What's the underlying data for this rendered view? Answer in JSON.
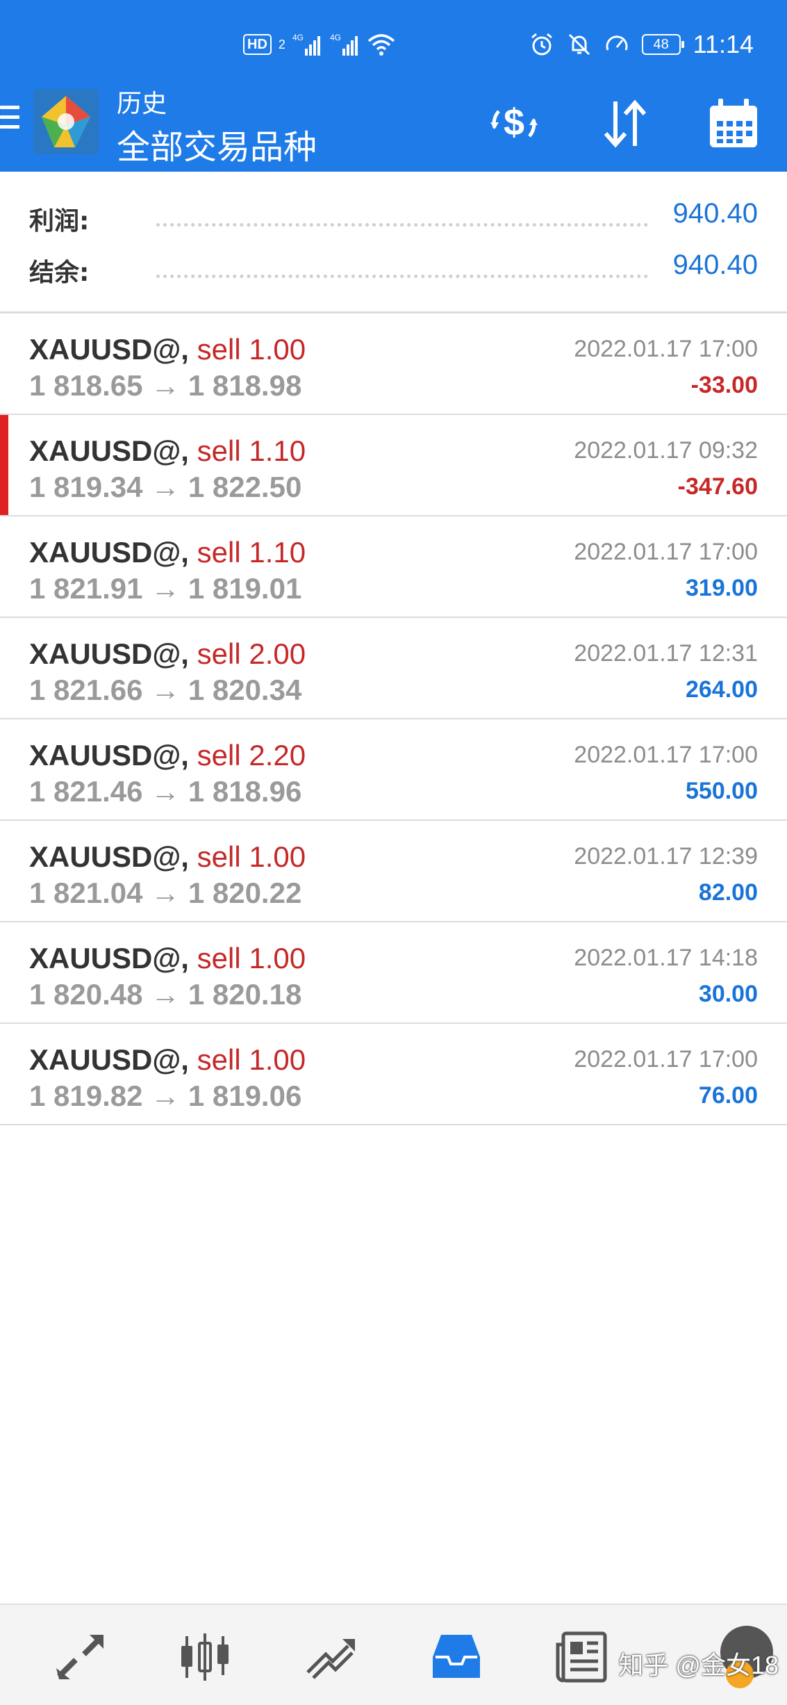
{
  "status_bar": {
    "hd_label": "HD",
    "hd_sub": "2",
    "battery": "48",
    "time": "11:14"
  },
  "header": {
    "subtitle": "历史",
    "title": "全部交易品种"
  },
  "summary": {
    "profit_label": "利润:",
    "profit_value": "940.40",
    "balance_label": "结余:",
    "balance_value": "940.40"
  },
  "trades": [
    {
      "symbol": "XAUUSD@,",
      "side": "sell 1.00",
      "prices": "1 818.65 → 1 818.98",
      "time": "2022.01.17 17:00",
      "profit": "-33.00"
    },
    {
      "symbol": "XAUUSD@,",
      "side": "sell 1.10",
      "prices": "1 819.34 → 1 822.50",
      "time": "2022.01.17 09:32",
      "profit": "-347.60"
    },
    {
      "symbol": "XAUUSD@,",
      "side": "sell 1.10",
      "prices": "1 821.91 → 1 819.01",
      "time": "2022.01.17 17:00",
      "profit": "319.00"
    },
    {
      "symbol": "XAUUSD@,",
      "side": "sell 2.00",
      "prices": "1 821.66 → 1 820.34",
      "time": "2022.01.17 12:31",
      "profit": "264.00"
    },
    {
      "symbol": "XAUUSD@,",
      "side": "sell 2.20",
      "prices": "1 821.46 → 1 818.96",
      "time": "2022.01.17 17:00",
      "profit": "550.00"
    },
    {
      "symbol": "XAUUSD@,",
      "side": "sell 1.00",
      "prices": "1 821.04 → 1 820.22",
      "time": "2022.01.17 12:39",
      "profit": "82.00"
    },
    {
      "symbol": "XAUUSD@,",
      "side": "sell 1.00",
      "prices": "1 820.48 → 1 820.18",
      "time": "2022.01.17 14:18",
      "profit": "30.00"
    },
    {
      "symbol": "XAUUSD@,",
      "side": "sell 1.00",
      "prices": "1 819.82 → 1 819.06",
      "time": "2022.01.17 17:00",
      "profit": "76.00"
    }
  ],
  "watermark": "知乎 @金女18",
  "colors": {
    "header_blue": "#1e7be8",
    "profit_blue": "#1a74d8",
    "loss_red": "#c62828",
    "active_marker": "#e02121"
  },
  "icons": {
    "header": [
      "currency-exchange-icon",
      "sort-icon",
      "calendar-icon"
    ],
    "nav": [
      "quotes-icon",
      "chart-icon",
      "trade-icon",
      "history-icon",
      "news-icon"
    ]
  }
}
